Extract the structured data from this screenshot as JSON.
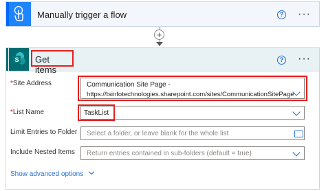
{
  "trigger": {
    "title": "Manually trigger a flow",
    "help_symbol": "?",
    "more_symbol": "···",
    "icon": "hand-touch-icon",
    "accent": "#1f85ff"
  },
  "connector": {
    "plus_symbol": "+"
  },
  "action": {
    "title": "Get items",
    "help_symbol": "?",
    "more_symbol": "···",
    "icon": "sharepoint-icon",
    "icon_letter": "S",
    "accent": "#036c70",
    "fields": {
      "site_address": {
        "required_mark": "*",
        "label": "Site Address",
        "value_line1": "Communication Site Page -",
        "value_line2": "https://tsinfotechnologies.sharepoint.com/sites/CommunicationSitePage"
      },
      "list_name": {
        "required_mark": "*",
        "label": "List Name",
        "value": "TaskList"
      },
      "limit_folder": {
        "label": "Limit Entries to Folder",
        "placeholder": "Select a folder, or leave blank for the whole list"
      },
      "nested_items": {
        "label": "Include Nested Items",
        "placeholder": "Return entries contained in sub-folders (default = true)"
      }
    },
    "advanced_link": "Show advanced options"
  },
  "highlight_color": "#e41f1f"
}
